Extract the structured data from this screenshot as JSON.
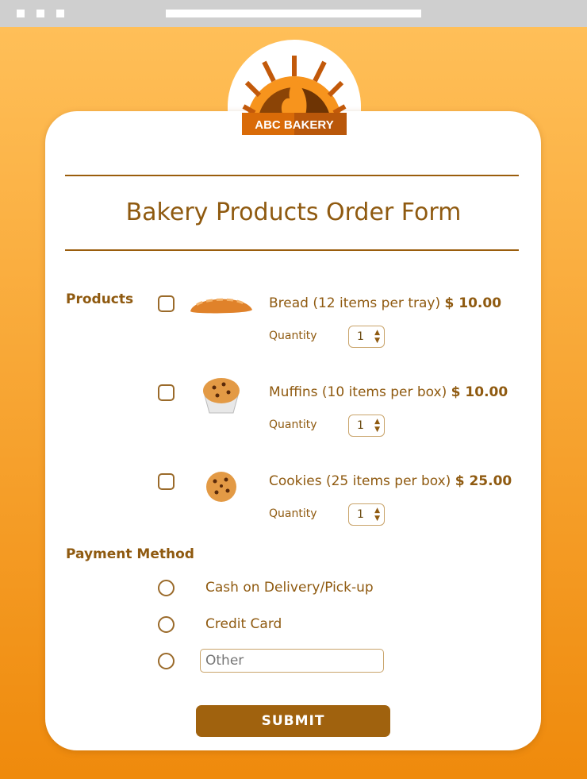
{
  "logo": {
    "text": "ABC BAKERY"
  },
  "form": {
    "title": "Bakery Products Order Form",
    "products_label": "Products",
    "quantity_label": "Quantity",
    "products": [
      {
        "name": "Bread (12 items per tray)",
        "price": "$ 10.00",
        "quantity": "1",
        "icon": "bread-icon"
      },
      {
        "name": "Muffins (10 items per box)",
        "price": "$ 10.00",
        "quantity": "1",
        "icon": "muffin-icon"
      },
      {
        "name": "Cookies (25 items per box)",
        "price": "$ 25.00",
        "quantity": "1",
        "icon": "cookie-icon"
      }
    ],
    "payment_label": "Payment Method",
    "payment_options": [
      "Cash on Delivery/Pick-up",
      "Credit Card"
    ],
    "other_placeholder": "Other",
    "submit_label": "SUBMIT"
  },
  "colors": {
    "accent": "#a0620e",
    "text": "#8f5a10",
    "bg_top": "#ffbf58",
    "bg_bottom": "#ef8a0c"
  }
}
